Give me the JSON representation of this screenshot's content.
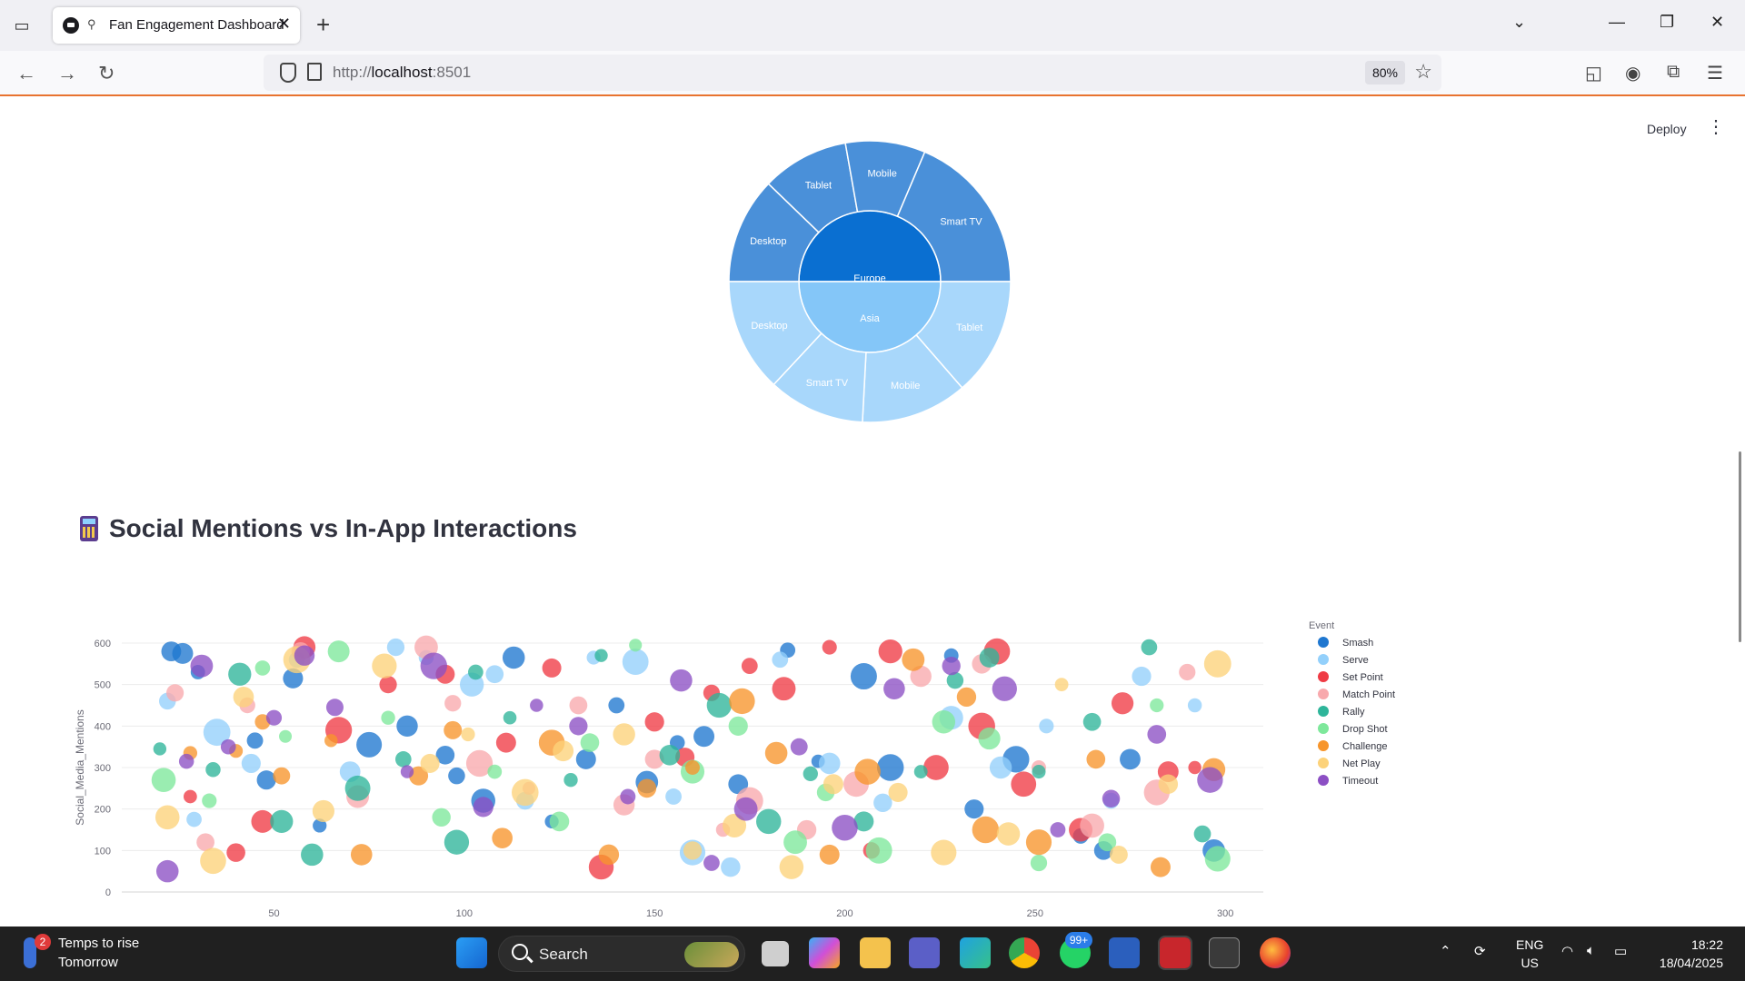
{
  "browser": {
    "tab_title": "Fan Engagement Dashboard",
    "url_prefix": "http://",
    "url_host": "localhost",
    "url_port": ":8501",
    "zoom": "80%"
  },
  "app": {
    "deploy_label": "Deploy",
    "section_title": "Social Mentions vs In-App Interactions"
  },
  "chart_data": [
    {
      "type": "sunburst",
      "center": null,
      "rings": [
        {
          "name": "Europe",
          "color": "#0a6fd1",
          "children": [
            {
              "name": "Desktop",
              "color": "#4a90d9"
            },
            {
              "name": "Tablet",
              "color": "#4a90d9"
            },
            {
              "name": "Mobile",
              "color": "#4a90d9"
            },
            {
              "name": "Smart TV",
              "color": "#4a90d9"
            }
          ]
        },
        {
          "name": "Asia",
          "color": "#84c6f8",
          "children": [
            {
              "name": "Tablet",
              "color": "#a8d7fb"
            },
            {
              "name": "Mobile",
              "color": "#a8d7fb"
            },
            {
              "name": "Smart TV",
              "color": "#a8d7fb"
            },
            {
              "name": "Desktop",
              "color": "#a8d7fb"
            }
          ]
        }
      ]
    },
    {
      "type": "scatter",
      "title": "",
      "xlabel": "",
      "ylabel": "Social_Media_Mentions",
      "xlim": [
        0,
        320
      ],
      "ylim": [
        0,
        600
      ],
      "x_ticks": [
        50,
        100,
        150,
        200,
        250,
        300
      ],
      "y_ticks": [
        0,
        100,
        200,
        300,
        400,
        500,
        600
      ],
      "grid": true,
      "legend_title": "Event",
      "legend_position": "right",
      "series": [
        {
          "name": "Smash",
          "color": "#1f77d0",
          "points": [
            [
              23,
              580
            ],
            [
              26,
              575
            ],
            [
              30,
              530
            ],
            [
              45,
              365
            ],
            [
              48,
              270
            ],
            [
              55,
              515
            ],
            [
              62,
              160
            ],
            [
              75,
              355
            ],
            [
              85,
              400
            ],
            [
              95,
              330
            ],
            [
              98,
              280
            ],
            [
              105,
              220
            ],
            [
              113,
              565
            ],
            [
              123,
              170
            ],
            [
              132,
              320
            ],
            [
              140,
              450
            ],
            [
              148,
              265
            ],
            [
              156,
              360
            ],
            [
              163,
              375
            ],
            [
              172,
              260
            ],
            [
              185,
              583
            ],
            [
              193,
              315
            ],
            [
              205,
              520
            ],
            [
              212,
              300
            ],
            [
              228,
              570
            ],
            [
              234,
              200
            ],
            [
              245,
              320
            ],
            [
              262,
              135
            ],
            [
              268,
              100
            ],
            [
              275,
              320
            ],
            [
              297,
              100
            ]
          ]
        },
        {
          "name": "Serve",
          "color": "#93d0fb",
          "points": [
            [
              22,
              460
            ],
            [
              29,
              175
            ],
            [
              35,
              385
            ],
            [
              44,
              310
            ],
            [
              56,
              560
            ],
            [
              70,
              290
            ],
            [
              82,
              590
            ],
            [
              90,
              565
            ],
            [
              102,
              500
            ],
            [
              108,
              525
            ],
            [
              116,
              220
            ],
            [
              134,
              565
            ],
            [
              145,
              555
            ],
            [
              155,
              230
            ],
            [
              160,
              95
            ],
            [
              170,
              60
            ],
            [
              183,
              560
            ],
            [
              196,
              310
            ],
            [
              210,
              215
            ],
            [
              228,
              420
            ],
            [
              241,
              300
            ],
            [
              253,
              400
            ],
            [
              270,
              220
            ],
            [
              278,
              520
            ],
            [
              292,
              450
            ]
          ]
        },
        {
          "name": "Set Point",
          "color": "#ef3b45",
          "points": [
            [
              28,
              230
            ],
            [
              40,
              95
            ],
            [
              47,
              170
            ],
            [
              58,
              590
            ],
            [
              67,
              390
            ],
            [
              80,
              500
            ],
            [
              95,
              525
            ],
            [
              111,
              360
            ],
            [
              123,
              540
            ],
            [
              136,
              60
            ],
            [
              150,
              410
            ],
            [
              158,
              325
            ],
            [
              165,
              480
            ],
            [
              175,
              545
            ],
            [
              184,
              490
            ],
            [
              196,
              590
            ],
            [
              207,
              100
            ],
            [
              212,
              580
            ],
            [
              224,
              300
            ],
            [
              236,
              400
            ],
            [
              240,
              580
            ],
            [
              247,
              260
            ],
            [
              262,
              150
            ],
            [
              273,
              455
            ],
            [
              285,
              290
            ],
            [
              292,
              300
            ]
          ]
        },
        {
          "name": "Match Point",
          "color": "#f8a9ad",
          "points": [
            [
              24,
              480
            ],
            [
              32,
              120
            ],
            [
              43,
              450
            ],
            [
              57,
              580
            ],
            [
              72,
              230
            ],
            [
              90,
              590
            ],
            [
              97,
              455
            ],
            [
              104,
              310
            ],
            [
              117,
              250
            ],
            [
              130,
              450
            ],
            [
              142,
              210
            ],
            [
              150,
              320
            ],
            [
              168,
              150
            ],
            [
              175,
              220
            ],
            [
              190,
              150
            ],
            [
              203,
              260
            ],
            [
              220,
              520
            ],
            [
              236,
              550
            ],
            [
              251,
              300
            ],
            [
              265,
              160
            ],
            [
              282,
              240
            ],
            [
              290,
              530
            ]
          ]
        },
        {
          "name": "Rally",
          "color": "#2eb59a",
          "points": [
            [
              20,
              345
            ],
            [
              34,
              295
            ],
            [
              41,
              525
            ],
            [
              52,
              170
            ],
            [
              60,
              90
            ],
            [
              72,
              250
            ],
            [
              84,
              320
            ],
            [
              98,
              120
            ],
            [
              103,
              530
            ],
            [
              112,
              420
            ],
            [
              128,
              270
            ],
            [
              136,
              570
            ],
            [
              154,
              330
            ],
            [
              167,
              450
            ],
            [
              180,
              170
            ],
            [
              191,
              285
            ],
            [
              205,
              170
            ],
            [
              220,
              290
            ],
            [
              229,
              510
            ],
            [
              238,
              565
            ],
            [
              251,
              290
            ],
            [
              265,
              410
            ],
            [
              280,
              590
            ],
            [
              294,
              140
            ]
          ]
        },
        {
          "name": "Drop Shot",
          "color": "#7ee89b",
          "points": [
            [
              21,
              270
            ],
            [
              33,
              220
            ],
            [
              47,
              540
            ],
            [
              53,
              375
            ],
            [
              67,
              580
            ],
            [
              80,
              420
            ],
            [
              94,
              180
            ],
            [
              108,
              290
            ],
            [
              125,
              170
            ],
            [
              133,
              360
            ],
            [
              145,
              595
            ],
            [
              160,
              290
            ],
            [
              172,
              400
            ],
            [
              187,
              120
            ],
            [
              195,
              240
            ],
            [
              209,
              100
            ],
            [
              226,
              410
            ],
            [
              238,
              370
            ],
            [
              251,
              70
            ],
            [
              269,
              120
            ],
            [
              282,
              450
            ],
            [
              298,
              80
            ]
          ]
        },
        {
          "name": "Challenge",
          "color": "#f7952b",
          "points": [
            [
              28,
              335
            ],
            [
              40,
              340
            ],
            [
              47,
              410
            ],
            [
              52,
              280
            ],
            [
              65,
              365
            ],
            [
              73,
              90
            ],
            [
              88,
              280
            ],
            [
              97,
              390
            ],
            [
              110,
              130
            ],
            [
              123,
              360
            ],
            [
              138,
              90
            ],
            [
              148,
              250
            ],
            [
              160,
              300
            ],
            [
              173,
              460
            ],
            [
              182,
              335
            ],
            [
              196,
              90
            ],
            [
              206,
              290
            ],
            [
              218,
              560
            ],
            [
              232,
              470
            ],
            [
              237,
              150
            ],
            [
              251,
              120
            ],
            [
              266,
              320
            ],
            [
              283,
              60
            ],
            [
              297,
              295
            ]
          ]
        },
        {
          "name": "Net Play",
          "color": "#fcd27a",
          "points": [
            [
              22,
              180
            ],
            [
              34,
              75
            ],
            [
              42,
              470
            ],
            [
              56,
              560
            ],
            [
              63,
              195
            ],
            [
              79,
              545
            ],
            [
              91,
              310
            ],
            [
              101,
              380
            ],
            [
              116,
              240
            ],
            [
              126,
              340
            ],
            [
              142,
              380
            ],
            [
              160,
              100
            ],
            [
              171,
              160
            ],
            [
              186,
              60
            ],
            [
              197,
              260
            ],
            [
              214,
              240
            ],
            [
              226,
              95
            ],
            [
              243,
              140
            ],
            [
              257,
              500
            ],
            [
              272,
              90
            ],
            [
              285,
              260
            ],
            [
              298,
              550
            ]
          ]
        },
        {
          "name": "Timeout",
          "color": "#8c4fc4",
          "points": [
            [
              22,
              50
            ],
            [
              27,
              315
            ],
            [
              31,
              545
            ],
            [
              38,
              350
            ],
            [
              50,
              420
            ],
            [
              58,
              570
            ],
            [
              66,
              445
            ],
            [
              85,
              290
            ],
            [
              92,
              545
            ],
            [
              105,
              205
            ],
            [
              119,
              450
            ],
            [
              130,
              400
            ],
            [
              143,
              230
            ],
            [
              157,
              510
            ],
            [
              165,
              70
            ],
            [
              174,
              200
            ],
            [
              188,
              350
            ],
            [
              200,
              155
            ],
            [
              213,
              490
            ],
            [
              228,
              545
            ],
            [
              242,
              490
            ],
            [
              256,
              150
            ],
            [
              270,
              225
            ],
            [
              282,
              380
            ],
            [
              296,
              270
            ]
          ]
        }
      ]
    }
  ],
  "taskbar": {
    "weather_badge": "2",
    "weather_title": "Temps to rise",
    "weather_sub": "Tomorrow",
    "search_label": "Search",
    "whatsapp_badge": "99+",
    "lang_1": "ENG",
    "lang_2": "US",
    "time": "18:22",
    "date": "18/04/2025"
  }
}
